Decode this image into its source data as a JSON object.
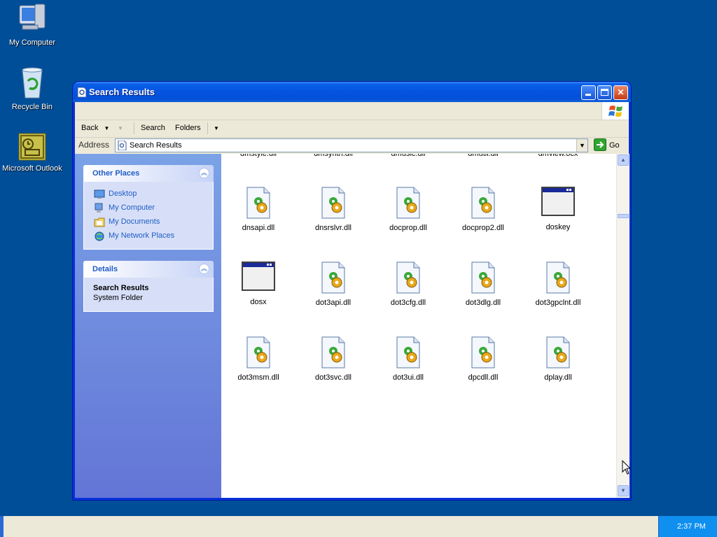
{
  "desktop": {
    "icons": [
      {
        "label": "My Computer",
        "icon": "my-computer-icon"
      },
      {
        "label": "Recycle Bin",
        "icon": "recycle-bin-icon"
      },
      {
        "label": "Microsoft Outlook",
        "icon": "outlook-icon"
      }
    ]
  },
  "window": {
    "title": "Search Results",
    "controls": {
      "minimize": "_",
      "maximize": "□",
      "close": "✕"
    }
  },
  "toolbar": {
    "back_label": "Back",
    "search_label": "Search",
    "folders_label": "Folders"
  },
  "address": {
    "label": "Address",
    "value": "Search Results",
    "go_label": "Go"
  },
  "taskpane": {
    "other_places": {
      "title": "Other Places",
      "links": [
        "Desktop",
        "My Computer",
        "My Documents",
        "My Network Places"
      ]
    },
    "details": {
      "title": "Details",
      "name": "Search Results",
      "type": "System Folder"
    }
  },
  "files": {
    "partial_row": [
      "dmstyle.dll",
      "dmsynth.dll",
      "dmusic.dll",
      "dmutil.dll",
      "dmview.ocx"
    ],
    "rows": [
      [
        "dnsapi.dll",
        "dnsrslvr.dll",
        "docprop.dll",
        "docprop2.dll",
        "doskey"
      ],
      [
        "dosx",
        "dot3api.dll",
        "dot3cfg.dll",
        "dot3dlg.dll",
        "dot3gpclnt.dll"
      ],
      [
        "dot3msm.dll",
        "dot3svc.dll",
        "dot3ui.dll",
        "dpcdll.dll",
        "dplay.dll"
      ]
    ],
    "icon_types": [
      [
        "dll",
        "dll",
        "dll",
        "dll",
        "exe"
      ],
      [
        "exe",
        "dll",
        "dll",
        "dll",
        "dll"
      ],
      [
        "dll",
        "dll",
        "dll",
        "dll",
        "dll"
      ]
    ]
  },
  "taskbar": {
    "clock": "2:37 PM"
  }
}
